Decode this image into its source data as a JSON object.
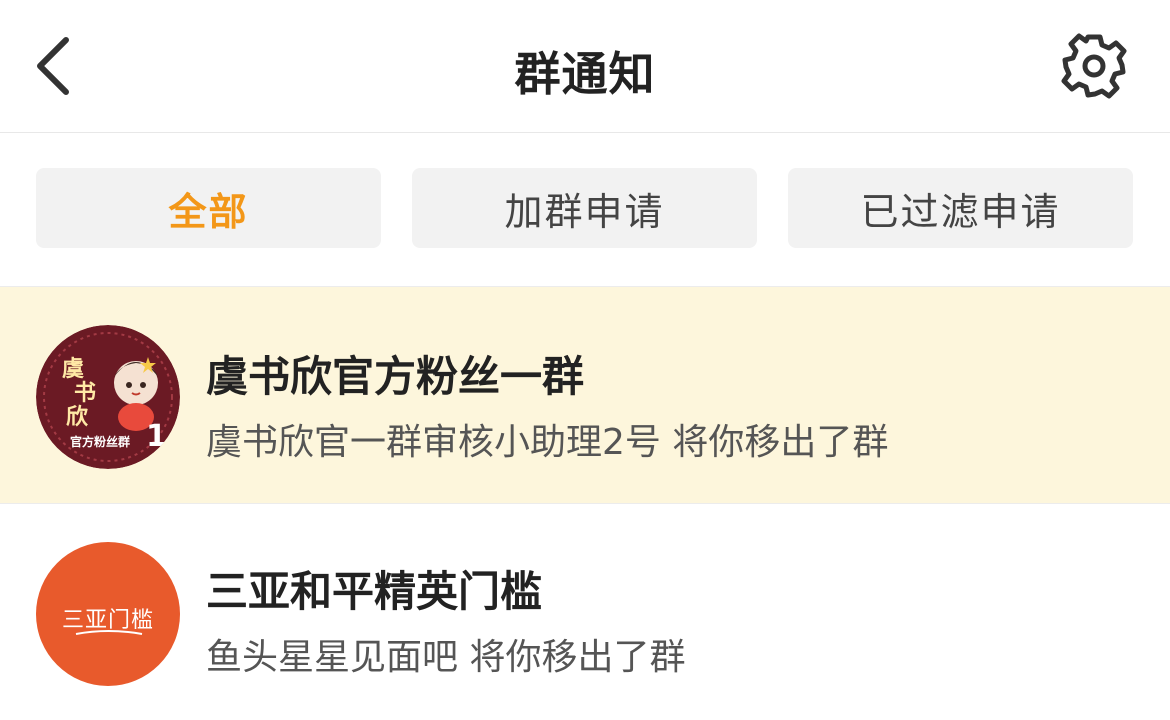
{
  "header": {
    "title": "群通知"
  },
  "tabs": [
    {
      "label": "全部",
      "active": true
    },
    {
      "label": "加群申请",
      "active": false
    },
    {
      "label": "已过滤申请",
      "active": false
    }
  ],
  "notifications": [
    {
      "group_name": "虞书欣官方粉丝一群",
      "message": "虞书欣官一群审核小助理2号 将你移出了群",
      "avatar_text": [
        "虞",
        "书",
        "欣",
        "官方粉丝群",
        "1"
      ],
      "highlighted": true
    },
    {
      "group_name": "三亚和平精英门槛",
      "message": "鱼头星星见面吧 将你移出了群",
      "avatar_text": "三亚门槛",
      "highlighted": false
    }
  ],
  "colors": {
    "accent": "#f39718",
    "highlight_bg": "#fdf6dc",
    "tab_bg": "#f2f2f2",
    "avatar1_bg": "#6b1a24",
    "avatar2_bg": "#e85a2c"
  }
}
